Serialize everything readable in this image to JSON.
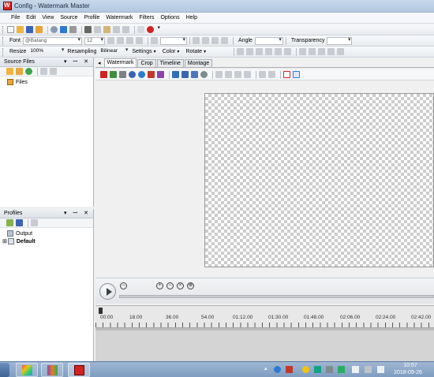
{
  "window": {
    "title": "Config - Watermark Master"
  },
  "menu": [
    "File",
    "Edit",
    "View",
    "Source",
    "Profile",
    "Watermark",
    "Filters",
    "Options",
    "Help"
  ],
  "toolbar2": {
    "font_label": "Font",
    "font_value": "@Batang",
    "size_value": "12",
    "angle_label": "Angle",
    "transparency_label": "Transparency"
  },
  "toolbar3": {
    "resize_label": "Resize",
    "resize_value": "100%",
    "resampling_label": "Resampling",
    "resampling_value": "Bilinear",
    "settings_label": "Settings",
    "color_label": "Color",
    "rotate_label": "Rotate"
  },
  "source_files": {
    "title": "Source Files",
    "items": [
      {
        "label": "Files"
      }
    ]
  },
  "profiles": {
    "title": "Profiles",
    "items": [
      {
        "label": "Output"
      },
      {
        "label": "Default"
      }
    ]
  },
  "tabs": [
    "Watermark",
    "Crop",
    "Timeline",
    "Montage"
  ],
  "timeline": {
    "ticks": [
      "00:00",
      "18.00",
      "36.00",
      "54.00",
      "01:12.00",
      "01:30.00",
      "01:48.00",
      "02:06.00",
      "02:24.00",
      "02:42.00"
    ]
  },
  "tray": {
    "time": "10:57",
    "date": "2018-09-26"
  },
  "colors": {
    "titlebar": "#c9d8ea",
    "taskbar": "#7f9dc1",
    "accent_red": "#d22222"
  },
  "icons": {
    "play": "play-icon",
    "open": "open-folder-icon",
    "save": "save-icon"
  }
}
